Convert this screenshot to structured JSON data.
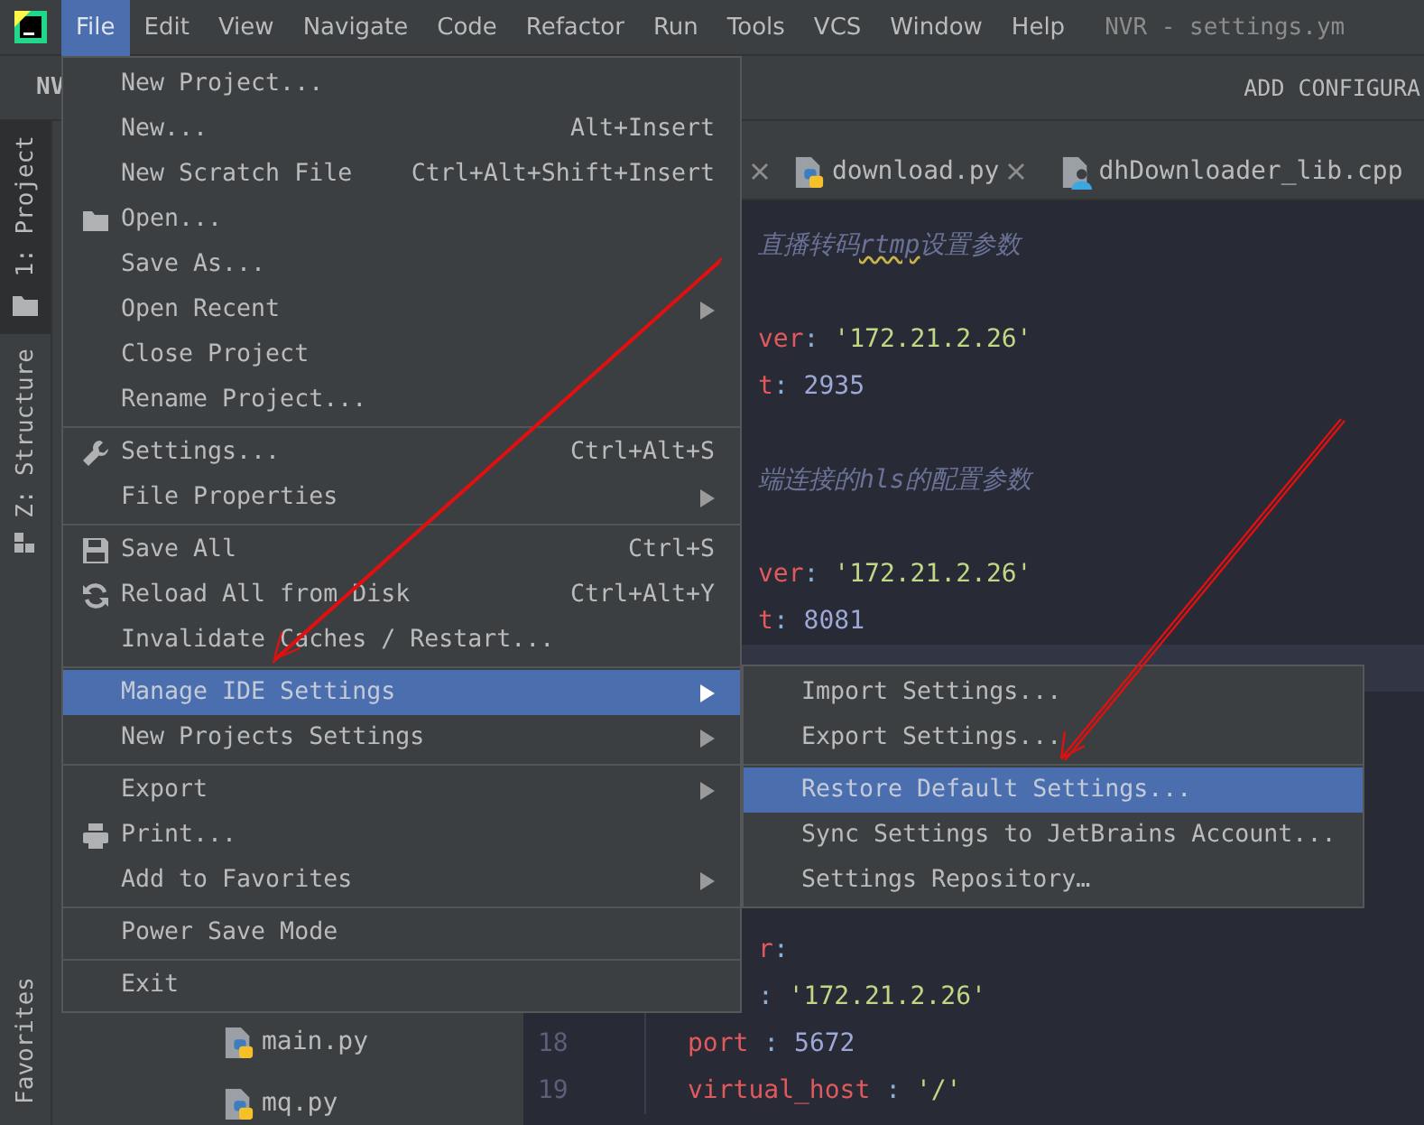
{
  "menubar": {
    "items": [
      {
        "label": "File",
        "selected": true
      },
      {
        "label": "Edit",
        "selected": false
      },
      {
        "label": "View",
        "selected": false
      },
      {
        "label": "Navigate",
        "selected": false
      },
      {
        "label": "Code",
        "selected": false
      },
      {
        "label": "Refactor",
        "selected": false
      },
      {
        "label": "Run",
        "selected": false
      },
      {
        "label": "Tools",
        "selected": false
      },
      {
        "label": "VCS",
        "selected": false
      },
      {
        "label": "Window",
        "selected": false
      },
      {
        "label": "Help",
        "selected": false
      }
    ],
    "title": "NVR - settings.ym"
  },
  "toolbar": {
    "project": "NV",
    "run_config": "ADD CONFIGURA"
  },
  "tool_strip": [
    {
      "label": "1: Project",
      "selected": true
    },
    {
      "label": "Z: Structure",
      "selected": false
    },
    {
      "label": "Favorites",
      "selected": false
    }
  ],
  "project_tree": {
    "items": [
      {
        "label": "main.py"
      },
      {
        "label": "mq.py"
      }
    ]
  },
  "editor": {
    "tabs": [
      {
        "label": "download.py"
      },
      {
        "label": "dhDownloader_lib.cpp"
      }
    ],
    "lines": [
      {
        "kind": "cut",
        "segments": [
          {
            "text": "直播转码",
            "kind": "comment"
          },
          {
            "text": "rtmp",
            "kind": "typo"
          },
          {
            "text": "设置参数",
            "kind": "comment"
          }
        ]
      },
      {
        "kind": "blank"
      },
      {
        "kind": "cut",
        "segments": [
          {
            "text": "ver",
            "kind": "key"
          },
          {
            "text": ": ",
            "kind": "punct"
          },
          {
            "text": "'172.21.2.26'",
            "kind": "string"
          }
        ]
      },
      {
        "kind": "cut",
        "segments": [
          {
            "text": "t",
            "kind": "key"
          },
          {
            "text": ": ",
            "kind": "punct"
          },
          {
            "text": "2935",
            "kind": "number"
          }
        ]
      },
      {
        "kind": "blank"
      },
      {
        "kind": "cut",
        "segments": [
          {
            "text": "端连接的hls的配置参数",
            "kind": "comment"
          }
        ]
      },
      {
        "kind": "blank"
      },
      {
        "kind": "cut",
        "segments": [
          {
            "text": "ver",
            "kind": "key"
          },
          {
            "text": ": ",
            "kind": "punct"
          },
          {
            "text": "'172.21.2.26'",
            "kind": "string"
          }
        ]
      },
      {
        "kind": "cut",
        "segments": [
          {
            "text": "t",
            "kind": "key"
          },
          {
            "text": ": ",
            "kind": "punct"
          },
          {
            "text": "8081",
            "kind": "number"
          }
        ]
      },
      {
        "kind": "blank",
        "current": true
      },
      {
        "kind": "blank"
      },
      {
        "kind": "blank"
      },
      {
        "kind": "blank"
      },
      {
        "kind": "blank"
      },
      {
        "kind": "blank"
      },
      {
        "kind": "cut",
        "segments": [
          {
            "text": "r",
            "kind": "key"
          },
          {
            "text": ":",
            "kind": "punct"
          }
        ]
      },
      {
        "kind": "cut",
        "segments": [
          {
            "text": ": ",
            "kind": "punct"
          },
          {
            "text": "'172.21.2.26'",
            "kind": "string"
          }
        ]
      },
      {
        "kind": "full",
        "number": "18",
        "segments": [
          {
            "text": "port",
            "kind": "key"
          },
          {
            "text": " : ",
            "kind": "punct"
          },
          {
            "text": "5672",
            "kind": "number"
          }
        ]
      },
      {
        "kind": "full",
        "number": "19",
        "segments": [
          {
            "text": "virtual_host",
            "kind": "key"
          },
          {
            "text": " : ",
            "kind": "punct"
          },
          {
            "text": "'/'",
            "kind": "string"
          }
        ]
      }
    ]
  },
  "file_menu": {
    "items": [
      {
        "kind": "item",
        "label": "New Project...",
        "selected": false
      },
      {
        "kind": "item",
        "label": "New...",
        "shortcut": "Alt+Insert",
        "selected": false
      },
      {
        "kind": "item",
        "label": "New Scratch File",
        "shortcut": "Ctrl+Alt+Shift+Insert",
        "selected": false
      },
      {
        "kind": "item",
        "label": "Open...",
        "selected": false
      },
      {
        "kind": "item",
        "label": "Save As...",
        "selected": false
      },
      {
        "kind": "item",
        "label": "Open Recent",
        "submenu": true,
        "selected": false
      },
      {
        "kind": "item",
        "label": "Close Project",
        "selected": false
      },
      {
        "kind": "item",
        "label": "Rename Project...",
        "selected": false
      },
      {
        "kind": "separator"
      },
      {
        "kind": "item",
        "label": "Settings...",
        "shortcut": "Ctrl+Alt+S",
        "selected": false
      },
      {
        "kind": "item",
        "label": "File Properties",
        "submenu": true,
        "selected": false
      },
      {
        "kind": "separator"
      },
      {
        "kind": "item",
        "label": "Save All",
        "shortcut": "Ctrl+S",
        "selected": false
      },
      {
        "kind": "item",
        "label": "Reload All from Disk",
        "shortcut": "Ctrl+Alt+Y",
        "selected": false
      },
      {
        "kind": "item",
        "label": "Invalidate Caches / Restart...",
        "selected": false
      },
      {
        "kind": "separator"
      },
      {
        "kind": "item",
        "label": "Manage IDE Settings",
        "submenu": true,
        "selected": true
      },
      {
        "kind": "item",
        "label": "New Projects Settings",
        "submenu": true,
        "selected": false
      },
      {
        "kind": "separator"
      },
      {
        "kind": "item",
        "label": "Export",
        "submenu": true,
        "selected": false
      },
      {
        "kind": "item",
        "label": "Print...",
        "selected": false
      },
      {
        "kind": "item",
        "label": "Add to Favorites",
        "submenu": true,
        "selected": false
      },
      {
        "kind": "separator"
      },
      {
        "kind": "item",
        "label": "Power Save Mode",
        "selected": false
      },
      {
        "kind": "separator"
      },
      {
        "kind": "item",
        "label": "Exit",
        "selected": false
      }
    ]
  },
  "submenu": {
    "items": [
      {
        "kind": "item",
        "label": "Import Settings...",
        "selected": false
      },
      {
        "kind": "item",
        "label": "Export Settings...",
        "selected": false
      },
      {
        "kind": "separator"
      },
      {
        "kind": "item",
        "label": "Restore Default Settings...",
        "selected": true
      },
      {
        "kind": "item",
        "label": "Sync Settings to JetBrains Account...",
        "selected": false
      },
      {
        "kind": "item",
        "label": "Settings Repository…",
        "selected": false
      }
    ]
  }
}
